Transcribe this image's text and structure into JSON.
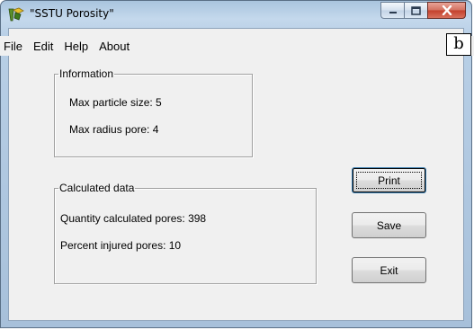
{
  "window": {
    "title": "\"SSTU Porosity\"",
    "app_icon": "app-icon",
    "caption_buttons": [
      "minimize-icon",
      "maximize-icon",
      "close-icon"
    ]
  },
  "menu": {
    "items": [
      "File",
      "Edit",
      "Help",
      "About"
    ]
  },
  "corner_label": "b",
  "information": {
    "legend": "Information",
    "max_particle_size": "Max particle size: 5",
    "max_radius_pore": "Max radius pore: 4"
  },
  "calculated": {
    "legend": "Calculated data",
    "quantity_pores": "Quantity calculated pores: 398",
    "percent_injured": "Percent injured pores: 10"
  },
  "buttons": {
    "print": "Print",
    "save": "Save",
    "exit": "Exit"
  },
  "colors": {
    "titlebar": "#b8cfe6",
    "client": "#f0f0f0",
    "close_button": "#c3402c"
  }
}
